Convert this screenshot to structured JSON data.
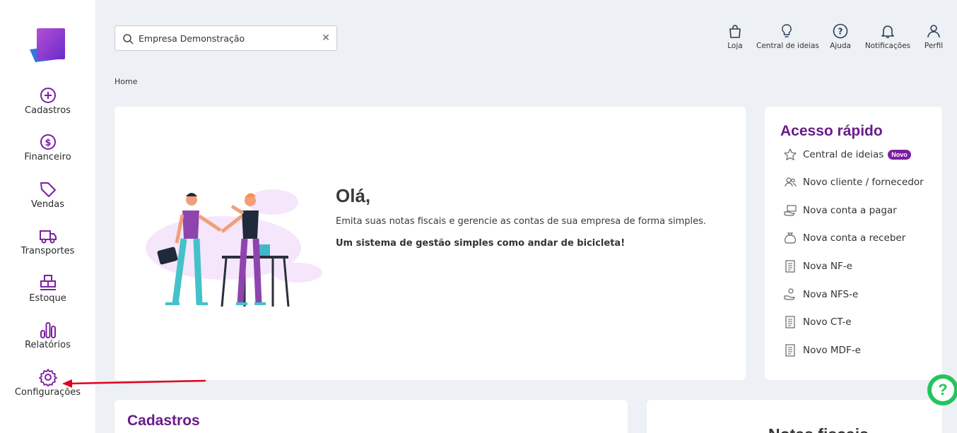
{
  "sidebar": {
    "items": [
      {
        "label": "Cadastros",
        "icon": "plus-circle-icon"
      },
      {
        "label": "Financeiro",
        "icon": "dollar-circle-icon"
      },
      {
        "label": "Vendas",
        "icon": "tag-icon"
      },
      {
        "label": "Transportes",
        "icon": "truck-icon"
      },
      {
        "label": "Estoque",
        "icon": "boxes-icon"
      },
      {
        "label": "Relatórios",
        "icon": "bar-chart-icon"
      },
      {
        "label": "Configurações",
        "icon": "gear-icon"
      }
    ]
  },
  "search": {
    "value": "Empresa Demonstração"
  },
  "topbar": {
    "items": [
      {
        "label": "Loja",
        "icon": "bag-icon"
      },
      {
        "label": "Central de ideias",
        "icon": "bulb-icon"
      },
      {
        "label": "Ajuda",
        "icon": "question-icon"
      },
      {
        "label": "Notificações",
        "icon": "bell-icon"
      },
      {
        "label": "Perfil",
        "icon": "user-icon"
      }
    ]
  },
  "breadcrumb": "Home",
  "hero": {
    "title": "Olá,",
    "text": "Emita suas notas fiscais e gerencie as contas de sua empresa de forma simples.",
    "tagline": "Um sistema de gestão simples como andar de bicicleta!"
  },
  "quick_access": {
    "title": "Acesso rápido",
    "badge": "Novo",
    "items": [
      {
        "label": "Central de ideias",
        "icon": "star-icon"
      },
      {
        "label": "Novo cliente / fornecedor",
        "icon": "users-icon"
      },
      {
        "label": "Nova conta a pagar",
        "icon": "money-hand-icon"
      },
      {
        "label": "Nova conta a receber",
        "icon": "money-bag-icon"
      },
      {
        "label": "Nova NF-e",
        "icon": "document-icon"
      },
      {
        "label": "Nova NFS-e",
        "icon": "service-hand-icon"
      },
      {
        "label": "Novo CT-e",
        "icon": "document-icon"
      },
      {
        "label": "Novo MDF-e",
        "icon": "document-icon"
      }
    ]
  },
  "sections": {
    "cadastros_title": "Cadastros",
    "notas_title": "Notas fiscais"
  },
  "colors": {
    "accent": "#7b1fa2",
    "heading": "#6a1b8a",
    "help": "#22c55e",
    "arrow": "#e3001b"
  }
}
